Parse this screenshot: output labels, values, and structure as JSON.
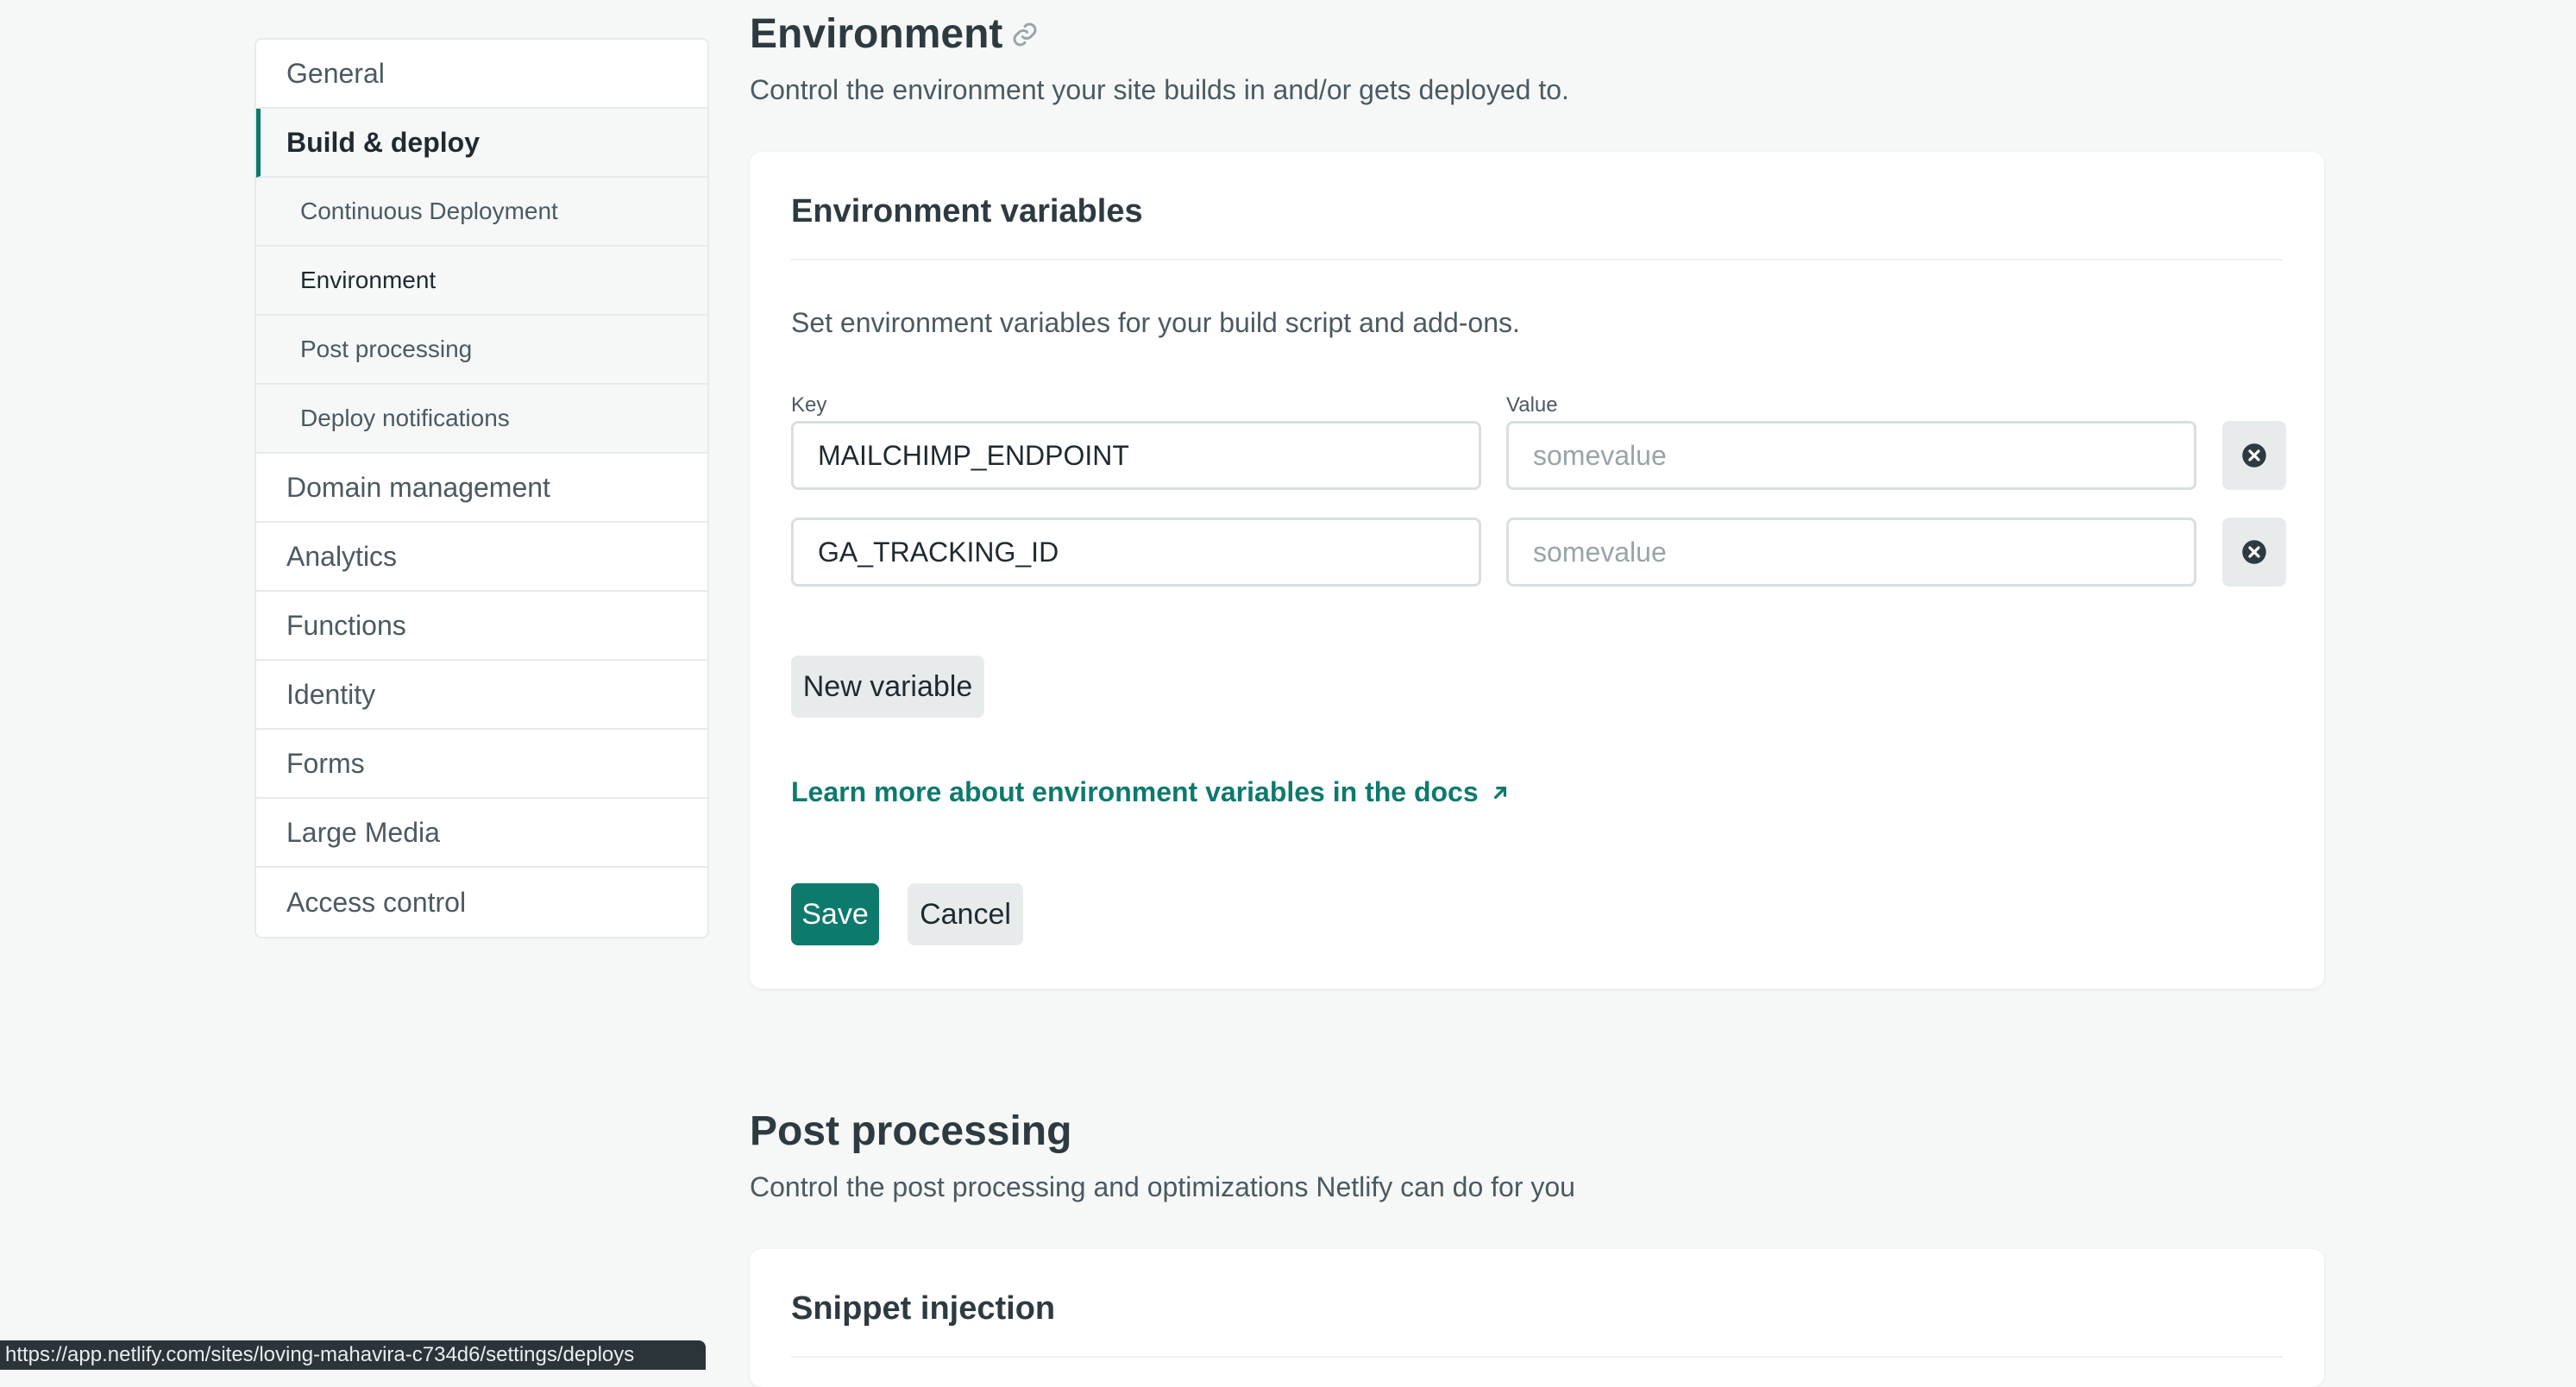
{
  "sidebar": {
    "items": [
      {
        "label": "General"
      },
      {
        "label": "Build & deploy"
      },
      {
        "label": "Domain management"
      },
      {
        "label": "Analytics"
      },
      {
        "label": "Functions"
      },
      {
        "label": "Identity"
      },
      {
        "label": "Forms"
      },
      {
        "label": "Large Media"
      },
      {
        "label": "Access control"
      }
    ],
    "subitems": [
      {
        "label": "Continuous Deployment"
      },
      {
        "label": "Environment"
      },
      {
        "label": "Post processing"
      },
      {
        "label": "Deploy notifications"
      }
    ]
  },
  "environment": {
    "title": "Environment",
    "description": "Control the environment your site builds in and/or gets deployed to.",
    "card": {
      "title": "Environment variables",
      "text": "Set environment variables for your build script and add-ons.",
      "key_label": "Key",
      "value_label": "Value",
      "variables": [
        {
          "key": "MAILCHIMP_ENDPOINT",
          "value_placeholder": "somevalue"
        },
        {
          "key": "GA_TRACKING_ID",
          "value_placeholder": "somevalue"
        }
      ],
      "new_variable_label": "New variable",
      "docs_link": "Learn more about environment variables in the docs",
      "save_label": "Save",
      "cancel_label": "Cancel"
    }
  },
  "post_processing": {
    "title": "Post processing",
    "description": "Control the post processing and optimizations Netlify can do for you",
    "card": {
      "title": "Snippet injection"
    }
  },
  "status_bar": {
    "url": "https://app.netlify.com/sites/loving-mahavira-c734d6/settings/deploys"
  },
  "colors": {
    "accent": "#0d7a6d",
    "background": "#f6f8f8",
    "text": "#2d3b41"
  }
}
